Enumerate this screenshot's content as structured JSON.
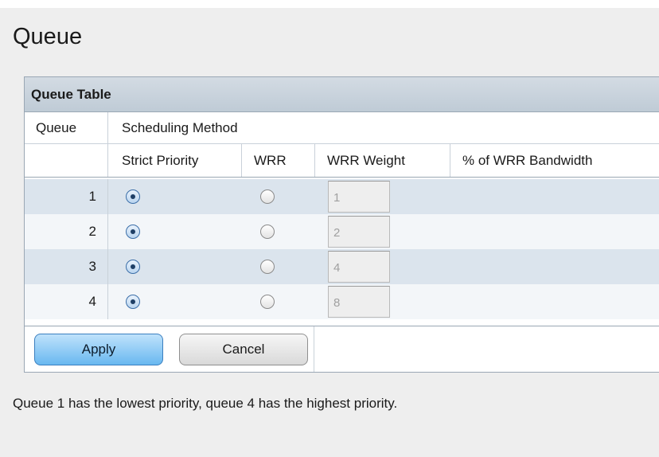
{
  "page": {
    "title": "Queue"
  },
  "queue_table": {
    "title": "Queue Table",
    "columns": {
      "queue": "Queue",
      "scheduling_method": "Scheduling Method",
      "strict_priority": "Strict Priority",
      "wrr": "WRR",
      "wrr_weight": "WRR Weight",
      "wrr_bandwidth": "% of WRR Bandwidth"
    },
    "rows": [
      {
        "queue": "1",
        "method": "Strict Priority",
        "wrr_weight": "1",
        "wrr_bandwidth": ""
      },
      {
        "queue": "2",
        "method": "Strict Priority",
        "wrr_weight": "2",
        "wrr_bandwidth": ""
      },
      {
        "queue": "3",
        "method": "Strict Priority",
        "wrr_weight": "4",
        "wrr_bandwidth": ""
      },
      {
        "queue": "4",
        "method": "Strict Priority",
        "wrr_weight": "8",
        "wrr_bandwidth": ""
      }
    ]
  },
  "buttons": {
    "apply": "Apply",
    "cancel": "Cancel"
  },
  "footnote": "Queue 1 has the lowest priority, queue 4 has the highest priority.",
  "colors": {
    "accent": "#69b8f0",
    "row_alt": "#dbe4ed",
    "header": "#c8d2dc"
  }
}
